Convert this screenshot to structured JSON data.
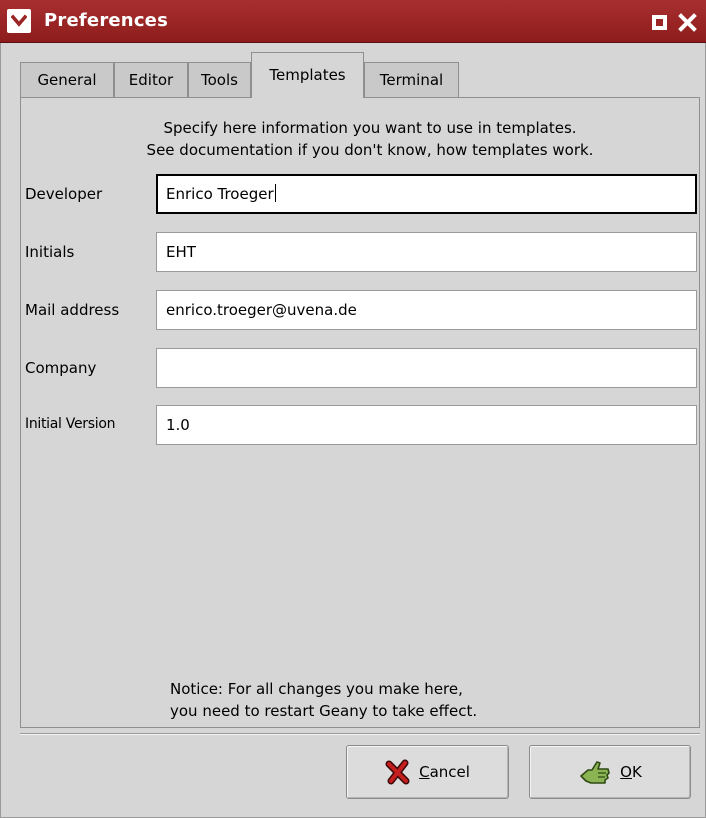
{
  "window": {
    "title": "Preferences"
  },
  "tabs": [
    {
      "label": "General"
    },
    {
      "label": "Editor"
    },
    {
      "label": "Tools"
    },
    {
      "label": "Templates",
      "active": true
    },
    {
      "label": "Terminal"
    }
  ],
  "templates": {
    "intro_line1": "Specify here information you want to use in templates.",
    "intro_line2": "See documentation if you don't know, how templates work.",
    "fields": [
      {
        "label": "Developer",
        "value": "Enrico Troeger"
      },
      {
        "label": "Initials",
        "value": "EHT"
      },
      {
        "label": "Mail address",
        "value": "enrico.troeger@uvena.de"
      },
      {
        "label": "Company",
        "value": ""
      },
      {
        "label": "Initial Version",
        "value": "1.0"
      }
    ],
    "notice_line1": "Notice: For all changes you make here,",
    "notice_line2": "you need to restart Geany to take effect."
  },
  "buttons": {
    "cancel_mnemonic": "C",
    "cancel_rest": "ancel",
    "ok_mnemonic": "O",
    "ok_rest": "K"
  },
  "icons": {
    "window_menu": "chevron-down-icon",
    "maximize": "maximize-icon",
    "close": "close-icon",
    "cancel": "cancel-x-icon",
    "ok": "ok-hand-icon"
  },
  "colors": {
    "titlebar": "#9b2424",
    "dialog_bg": "#d6d6d6",
    "cancel_icon": "#b01818",
    "ok_icon": "#6f9a3a"
  }
}
